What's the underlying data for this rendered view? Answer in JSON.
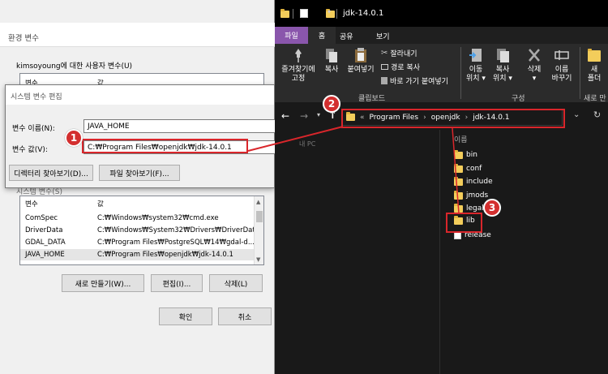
{
  "env_window": {
    "title": "환경 변수",
    "user_vars_label": "kimsoyoung에 대한 사용자 변수(U)",
    "user_list_header_var": "변수",
    "user_list_header_val": "값",
    "system_vars_label": "시스템 변수(S)",
    "system_list": {
      "header_var": "변수",
      "header_val": "값",
      "rows": [
        {
          "var": "ComSpec",
          "val": "C:₩Windows₩system32₩cmd.exe"
        },
        {
          "var": "DriverData",
          "val": "C:₩Windows₩System32₩Drivers₩DriverData"
        },
        {
          "var": "GDAL_DATA",
          "val": "C:₩Program Files₩PostgreSQL₩14₩gdal-d..."
        },
        {
          "var": "JAVA_HOME",
          "val": "C:₩Program Files₩openjdk₩jdk-14.0.1"
        }
      ]
    },
    "new_button": "새로 만들기(W)...",
    "edit_button": "편집(I)...",
    "delete_button": "삭제(L)",
    "ok_button": "확인",
    "cancel_button": "취소"
  },
  "edit_dialog": {
    "title": "시스템 변수 편집",
    "name_label": "변수 이름(N):",
    "name_value": "JAVA_HOME",
    "value_label": "변수 값(V):",
    "value_value": "C:₩Program Files₩openjdk₩jdk-14.0.1",
    "browse_dir_button": "디렉터리 찾아보기(D)...",
    "browse_file_button": "파일 찾아보기(F)..."
  },
  "explorer": {
    "title": "jdk-14.0.1",
    "tabs": [
      "파일",
      "홈",
      "공유",
      "보기"
    ],
    "ribbon": {
      "pin": "즐겨찾기에\n고정",
      "copy": "복사",
      "paste": "붙여넣기",
      "cut": "잘라내기",
      "copy_path": "경로 복사",
      "paste_shortcut": "바로 가기 붙여넣기",
      "clipboard_group": "클립보드",
      "move_to": "이동\n위치 ▾",
      "copy_to": "복사\n위치 ▾",
      "delete": "삭제\n▾",
      "rename": "이름\n바꾸기",
      "organize_group": "구성",
      "new_folder": "새\n폴더",
      "new_group": "새로 만"
    },
    "address": {
      "prefix": "«",
      "segments": [
        "Program Files",
        "openjdk",
        "jdk-14.0.1"
      ]
    },
    "column_name": "이름",
    "nav_item": "내 PC",
    "items": [
      {
        "name": "bin",
        "type": "folder"
      },
      {
        "name": "conf",
        "type": "folder"
      },
      {
        "name": "include",
        "type": "folder"
      },
      {
        "name": "jmods",
        "type": "folder"
      },
      {
        "name": "legal",
        "type": "folder"
      },
      {
        "name": "lib",
        "type": "folder"
      },
      {
        "name": "release",
        "type": "file"
      }
    ]
  },
  "callouts": [
    "1",
    "2",
    "3"
  ],
  "colors": {
    "accent_purple": "#8a56ac",
    "callout_red": "#d32f2f",
    "highlight_red": "#d9262b",
    "folder_yellow": "#f3cd5b"
  }
}
